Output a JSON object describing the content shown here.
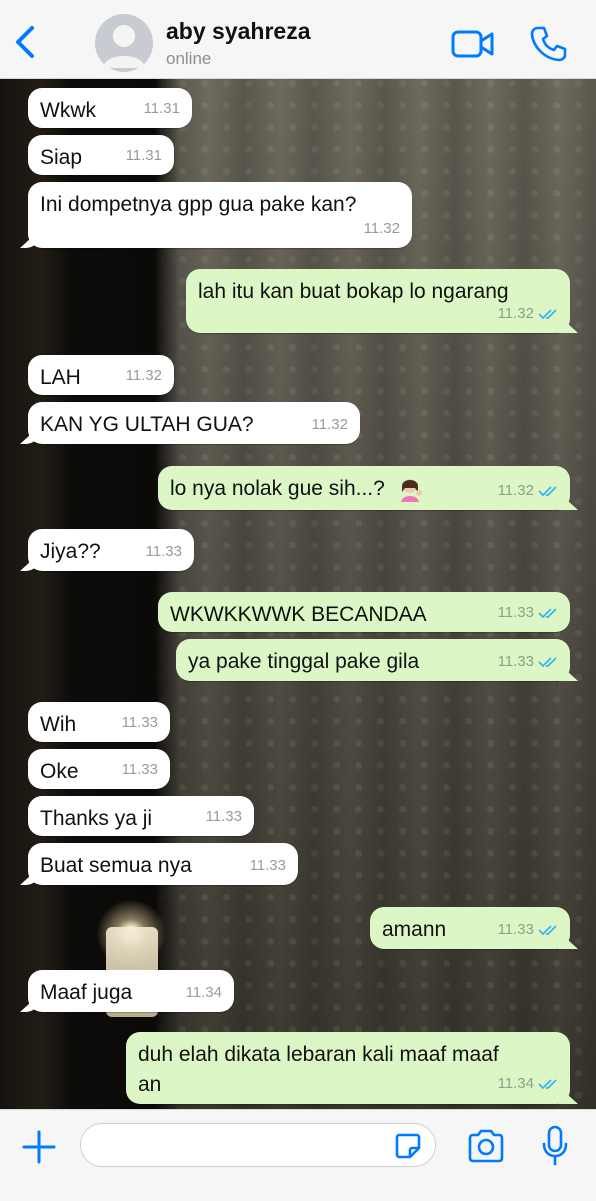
{
  "header": {
    "contact_name": "aby syahreza",
    "status": "online"
  },
  "colors": {
    "accent": "#007aff",
    "incoming_bubble": "#ffffff",
    "outgoing_bubble": "#dcf7c5",
    "read_ticks": "#34b7f1"
  },
  "icons": {
    "back": "chevron-left-icon",
    "video": "video-camera-icon",
    "call": "phone-icon",
    "plus": "plus-icon",
    "sticker": "sticker-icon",
    "camera": "camera-icon",
    "mic": "microphone-icon"
  },
  "messages": [
    {
      "direction": "in",
      "text": "Wkwk",
      "time": "11.31"
    },
    {
      "direction": "in",
      "text": "Siap",
      "time": "11.31"
    },
    {
      "direction": "in",
      "text": "Ini dompetnya gpp gua pake kan?",
      "time": "11.32"
    },
    {
      "direction": "out",
      "text": "lah itu kan buat bokap lo ngarang",
      "time": "11.32",
      "read": true
    },
    {
      "direction": "in",
      "text": "LAH",
      "time": "11.32"
    },
    {
      "direction": "in",
      "text": "KAN YG ULTAH GUA?",
      "time": "11.32"
    },
    {
      "direction": "out",
      "text": "lo nya nolak gue sih...?",
      "time": "11.32",
      "read": true,
      "emoji": "woman-tipping-hand"
    },
    {
      "direction": "in",
      "text": "Jiya??",
      "time": "11.33"
    },
    {
      "direction": "out",
      "text": "WKWKKWWK BECANDAA",
      "time": "11.33",
      "read": true
    },
    {
      "direction": "out",
      "text": "ya pake tinggal pake gila",
      "time": "11.33",
      "read": true
    },
    {
      "direction": "in",
      "text": "Wih",
      "time": "11.33"
    },
    {
      "direction": "in",
      "text": "Oke",
      "time": "11.33"
    },
    {
      "direction": "in",
      "text": "Thanks ya ji",
      "time": "11.33"
    },
    {
      "direction": "in",
      "text": "Buat semua nya",
      "time": "11.33"
    },
    {
      "direction": "out",
      "text": "amann",
      "time": "11.33",
      "read": true
    },
    {
      "direction": "in",
      "text": "Maaf juga",
      "time": "11.34"
    },
    {
      "direction": "out",
      "text": "duh elah dikata lebaran kali maaf maaf\nan",
      "time": "11.34",
      "read": true
    }
  ],
  "input": {
    "value": "",
    "placeholder": ""
  }
}
